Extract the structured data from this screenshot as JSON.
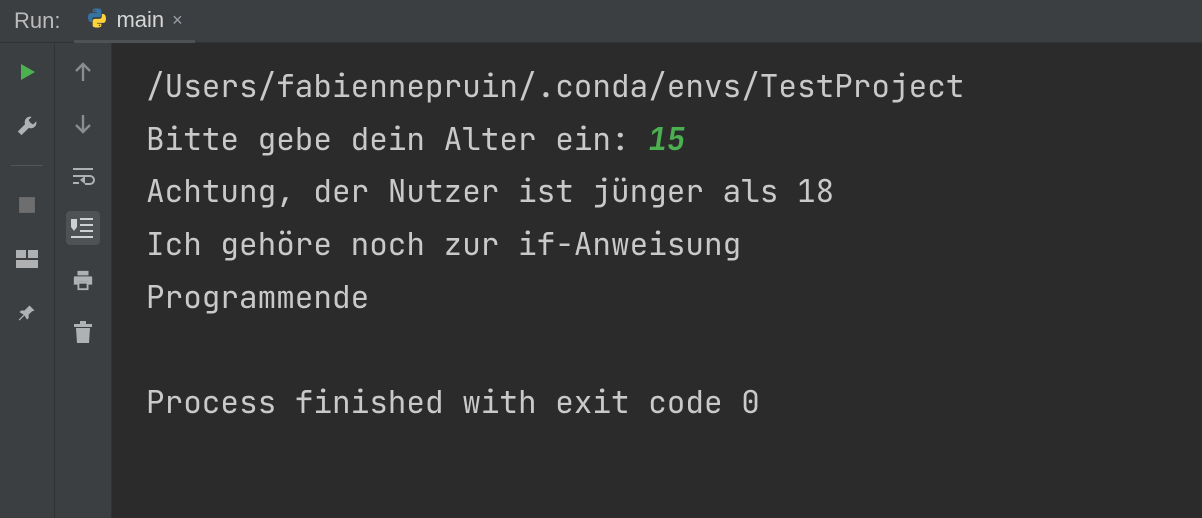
{
  "header": {
    "run_label": "Run:",
    "tab_title": "main",
    "tab_close": "×"
  },
  "toolbar_left": [
    {
      "name": "rerun",
      "icon": "play-green"
    },
    {
      "name": "modify-run-config",
      "icon": "wrench"
    },
    {
      "name": "stop",
      "icon": "stop"
    },
    {
      "name": "layout",
      "icon": "layout"
    },
    {
      "name": "pin",
      "icon": "pin"
    }
  ],
  "toolbar_right": [
    {
      "name": "up",
      "icon": "arrow-up"
    },
    {
      "name": "down",
      "icon": "arrow-down"
    },
    {
      "name": "soft-wrap",
      "icon": "softwrap"
    },
    {
      "name": "scroll-to-end",
      "icon": "scroll-end",
      "active": true
    },
    {
      "name": "print",
      "icon": "printer"
    },
    {
      "name": "clear-all",
      "icon": "trash"
    }
  ],
  "console": {
    "path_line": "/Users/fabiennepruin/.conda/envs/TestProject",
    "prompt_text": "Bitte gebe dein Alter ein: ",
    "user_input": "15",
    "lines_after": [
      "Achtung, der Nutzer ist jünger als 18",
      "Ich gehöre noch zur if-Anweisung",
      "Programmende",
      "",
      "Process finished with exit code 0"
    ]
  }
}
